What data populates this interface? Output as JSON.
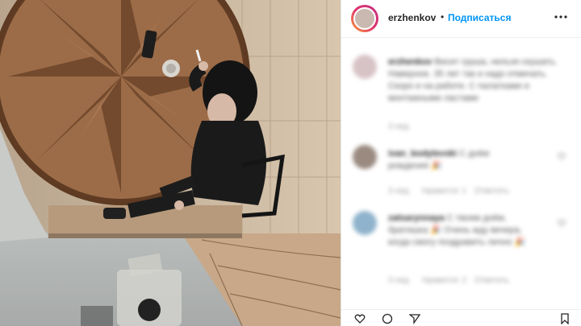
{
  "header": {
    "username": "erzhenkov",
    "separator": "•",
    "follow_label": "Подписаться",
    "more_icon": "ellipsis-icon"
  },
  "caption": {
    "username": "erzhenkov",
    "text_lines": [
      "Висит груша, нельзя скушать.",
      "Наверное. 35 лет так и надо отмечать.",
      "Скоро и на работе. С палатками и",
      "монтажными ластами"
    ],
    "time": "3 нед."
  },
  "comments": [
    {
      "username": "ivan_bodylevski",
      "text_lines": [
        "С днём",
        "рождения 🎉"
      ],
      "time": "3 нед.",
      "likes": "Нравится: 1",
      "reply": "Ответить"
    },
    {
      "username": "zatsarynnaya",
      "text_lines": [
        "С твоим днём,",
        "братишка 🎉 Очень жду вечера,",
        "когда смогу поздравить лично 🎉"
      ],
      "time": "3 нед.",
      "likes": "Нравится: 2",
      "reply": "Ответить"
    }
  ],
  "colors": {
    "accent": "#0095f6",
    "text": "#262626",
    "muted": "#8e8e8e"
  }
}
